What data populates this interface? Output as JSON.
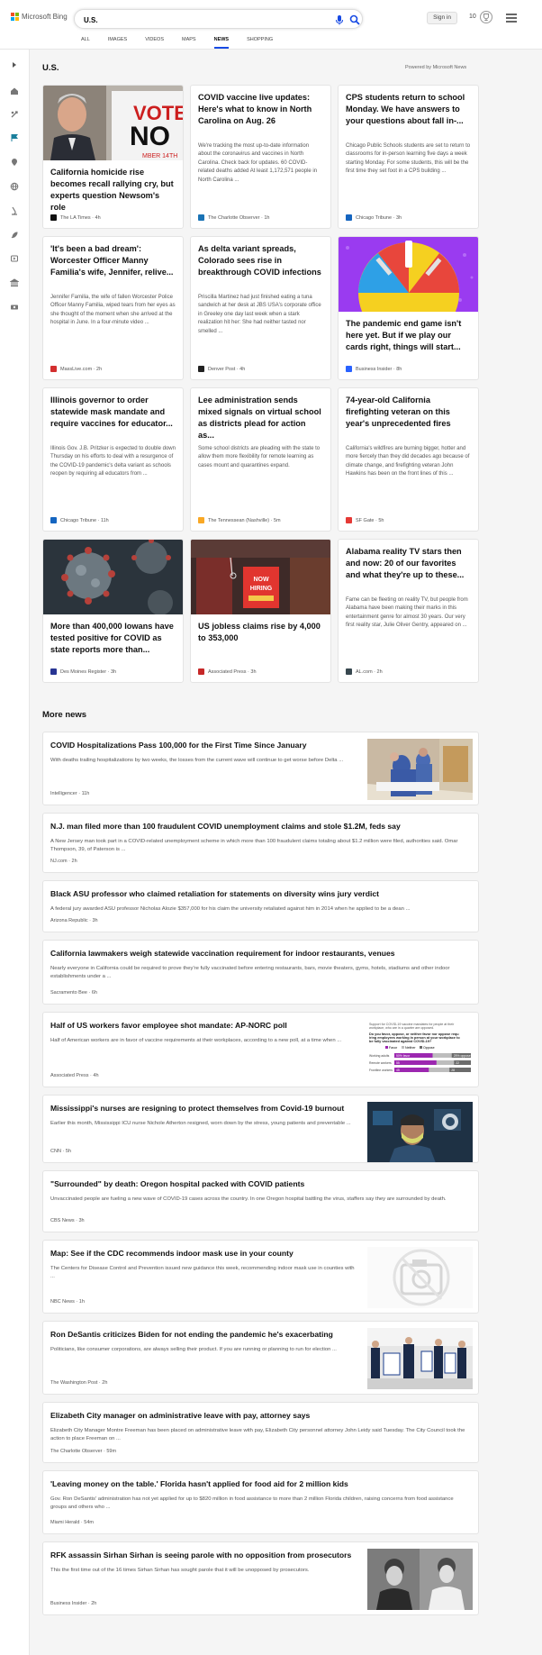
{
  "header": {
    "brand": "Microsoft Bing",
    "search_value": "U.S.",
    "signin": "Sign in",
    "points": "10",
    "tabs": [
      {
        "label": "ALL"
      },
      {
        "label": "IMAGES"
      },
      {
        "label": "VIDEOS"
      },
      {
        "label": "MAPS"
      },
      {
        "label": "NEWS"
      },
      {
        "label": "SHOPPING"
      }
    ],
    "active_tab": "NEWS"
  },
  "rail_icons": [
    "expand-icon",
    "home-icon",
    "tools-icon",
    "flag-icon",
    "location-icon",
    "globe-icon",
    "microscope-icon",
    "rocket-icon",
    "entertainment-icon",
    "bank-icon",
    "money-icon"
  ],
  "section": {
    "title": "U.S.",
    "powered": "Powered by Microsoft News"
  },
  "top_cards": [
    {
      "title": "California homicide rise becomes recall rallying cry, but experts question Newsom's role",
      "snippet": "",
      "source": "The LA Times",
      "time": "4h",
      "image": "newsom-vote-no",
      "fav_color": "#111111"
    },
    {
      "title": "COVID vaccine live updates: Here's what to know in North Carolina on Aug. 26",
      "snippet": "We're tracking the most up-to-date information about the coronavirus and vaccines in North Carolina. Check back for updates. 60 COVID-related deaths added At least 1,172,571 people in North Carolina ...",
      "source": "The Charlotte Observer",
      "time": "1h",
      "fav_color": "#1a73b5"
    },
    {
      "title": "CPS students return to school Monday. We have answers to your questions about fall in-...",
      "snippet": "Chicago Public Schools students are set to return to classrooms for in-person learning five days a week starting Monday. For some students, this will be the first time they set foot in a CPS building ...",
      "source": "Chicago Tribune",
      "time": "3h",
      "fav_color": "#1565c0"
    },
    {
      "title": "'It's been a bad dream': Worcester Officer Manny Familia's wife, Jennifer, relive...",
      "snippet": "Jennifer Familia, the wife of fallen Worcester Police Officer Manny Familia, wiped tears from her eyes as she thought of the moment when she arrived at the hospital in June. In a four-minute video ...",
      "source": "MassLive.com",
      "time": "2h",
      "fav_color": "#d32f2f"
    },
    {
      "title": "As delta variant spreads, Colorado sees rise in breakthrough COVID infections",
      "snippet": "Priscilla Martinez had just finished eating a tuna sandwich at her desk at JBS USA's corporate office in Greeley one day last week when a stark realization hit her: She had neither tasted nor smelled ...",
      "source": "Denver Post",
      "time": "4h",
      "fav_color": "#222222"
    },
    {
      "title": "The pandemic end game isn't here yet. But if we play our cards right, things will start...",
      "snippet": "",
      "source": "Business Insider",
      "time": "8h",
      "image": "vaccine-wheel",
      "fav_color": "#2962ff"
    },
    {
      "title": "Illinois governor to order statewide mask mandate and require vaccines for educator...",
      "snippet": "Illinois Gov. J.B. Pritzker is expected to double down Thursday on his efforts to deal with a resurgence of the COVID-19 pandemic's delta variant as schools reopen by requiring all educators from ...",
      "source": "Chicago Tribune",
      "time": "11h",
      "fav_color": "#1565c0"
    },
    {
      "title": "Lee administration sends mixed signals on virtual school as districts plead for action as...",
      "snippet": "Some school districts are pleading with the state to allow them more flexibility for remote learning as cases mount and quarantines expand.",
      "source": "The Tennessean (Nashville)",
      "time": "5m",
      "fav_color": "#f9a825"
    },
    {
      "title": "74-year-old California firefighting veteran on this year's unprecedented fires",
      "snippet": "California's wildfires are burning bigger, hotter and more fiercely than they did decades ago because of climate change, and firefighting veteran John Hawkins has been on the front lines of this ...",
      "source": "SF Gate",
      "time": "5h",
      "fav_color": "#e53935"
    },
    {
      "title": "More than 400,000 Iowans have tested positive for COVID as state reports more than...",
      "snippet": "",
      "source": "Des Moines Register",
      "time": "3h",
      "image": "virus",
      "fav_color": "#283593"
    },
    {
      "title": "US jobless claims rise by 4,000 to 353,000",
      "snippet": "",
      "source": "Associated Press",
      "time": "3h",
      "image": "hiring-sign",
      "fav_color": "#c62828"
    },
    {
      "title": "Alabama reality TV stars then and now: 20 of our favorites and what they're up to these...",
      "snippet": "Fame can be fleeting on reality TV, but people from Alabama have been making their marks in this entertainment genre for almost 30 years. Our very first reality star, Julie Oliver Gentry, appeared on ...",
      "source": "AL.com",
      "time": "2h",
      "fav_color": "#37474f"
    }
  ],
  "more_news": {
    "title": "More news",
    "items": [
      {
        "title": "COVID Hospitalizations Pass 100,000 for the First Time Since January",
        "snippet": "With deaths trailing hospitalizations by two weeks, the losses from the current wave will continue to get worse before Delta ...",
        "source": "Intelligencer",
        "time": "11h",
        "image": "hospital",
        "fav_color": "#111111"
      },
      {
        "title": "N.J. man filed more than 100 fraudulent COVID unemployment claims and stole $1.2M, feds say",
        "snippet": "A New Jersey man took part in a COVID-related unemployment scheme in which more than 100 fraudulent claims totaling about $1.2 million were filed, authorities said. Omar Thompson, 39, of Paterson is ...",
        "source": "NJ.com",
        "time": "2h",
        "fav_color": "#555555"
      },
      {
        "title": "Black ASU professor who claimed retaliation for statements on diversity wins jury verdict",
        "snippet": "A federal jury awarded ASU professor Nicholas Alozie $357,000 for his claim the university retaliated against him in 2014 when he applied to be a dean ...",
        "source": "Arizona Republic",
        "time": "3h",
        "fav_color": "#f9a825"
      },
      {
        "title": "California lawmakers weigh statewide vaccination requirement for indoor restaurants, venues",
        "snippet": "Nearly everyone in California could be required to prove they're fully vaccinated before entering restaurants, bars, movie theaters, gyms, hotels, stadiums and other indoor establishments under a ...",
        "source": "Sacramento Bee",
        "time": "6h",
        "fav_color": "#1565c0"
      },
      {
        "title": "Half of US workers favor employee shot mandate: AP-NORC poll",
        "snippet": "Half of American workers are in favor of vaccine requirements at their workplaces, according to a new poll, at a time when ...",
        "source": "Associated Press",
        "time": "4h",
        "image": "poll",
        "fav_color": "#c62828",
        "poll": {
          "heading": "Support for COVID-19 vaccine mandates for people at their workplace, who are in a quarter are opposed.",
          "question": "Do you favor, oppose, or neither favor nor oppose requiring employees working in person at your workplace to be fully vaccinated against COVID-19?",
          "legend": [
            "Favor",
            "Neither",
            "Oppose"
          ],
          "rows": [
            {
              "label": "Working adults",
              "favor": 50,
              "favor_text": "50% favor",
              "oppose": 25,
              "oppose_text": "25% oppose"
            },
            {
              "label": "Remote workers",
              "favor": 55,
              "favor_text": "55",
              "oppose": 22,
              "oppose_text": "22"
            },
            {
              "label": "Frontline workers",
              "favor": 45,
              "favor_text": "45",
              "oppose": 28,
              "oppose_text": "28"
            }
          ]
        }
      },
      {
        "title": "Mississippi's nurses are resigning to protect themselves from Covid-19 burnout",
        "snippet": "Earlier this month, Mississippi ICU nurse Nichole Atherton resigned, worn down by the stress, young patients and preventable ...",
        "source": "CNN",
        "time": "5h",
        "image": "nurse",
        "fav_color": "#cc0000"
      },
      {
        "title": "\"Surrounded\" by death: Oregon hospital packed with COVID patients",
        "snippet": "Unvaccinated people are fueling a new wave of COVID-19 cases across the country. In one Oregon hospital battling the virus, staffers say they are surrounded by death.",
        "source": "CBS News",
        "time": "3h",
        "fav_color": "#111111"
      },
      {
        "title": "Map: See if the CDC recommends indoor mask use in your county",
        "snippet": "The Centers for Disease Control and Prevention issued new guidance this week, recommending indoor mask use in counties with ...",
        "source": "NBC News",
        "time": "1h",
        "image": "placeholder",
        "fav_color": "#333333"
      },
      {
        "title": "Ron DeSantis criticizes Biden for not ending the pandemic he's exacerbating",
        "snippet": "Politicians, like consumer corporations, are always selling their product. If you are running or planning to run for election ...",
        "source": "The Washington Post",
        "time": "2h",
        "image": "press",
        "fav_color": "#111111"
      },
      {
        "title": "Elizabeth City manager on administrative leave with pay, attorney says",
        "snippet": "Elizabeth City Manager Montre Freeman has been placed on administrative leave with pay, Elizabeth City personnel attorney John Leidy said Tuesday. The City Council took the action to place Freeman on ...",
        "source": "The Charlotte Observer",
        "time": "59m",
        "fav_color": "#1a73b5"
      },
      {
        "title": "'Leaving money on the table.' Florida hasn't applied for food aid for 2 million kids",
        "snippet": "Gov. Ron DeSantis' administration has not yet applied for up to $820 million in food assistance to more than 2 million Florida children, raising concerns from food assistance groups and others who ...",
        "source": "Miami Herald",
        "time": "54m",
        "fav_color": "#0277bd"
      },
      {
        "title": "RFK assassin Sirhan Sirhan is seeing parole with no opposition from prosecutors",
        "snippet": "This the first time out of the 16 times Sirhan Sirhan has sought parole that it will be unopposed by prosecutors.",
        "source": "Business Insider",
        "time": "2h",
        "image": "sirhan",
        "fav_color": "#2962ff"
      }
    ]
  }
}
